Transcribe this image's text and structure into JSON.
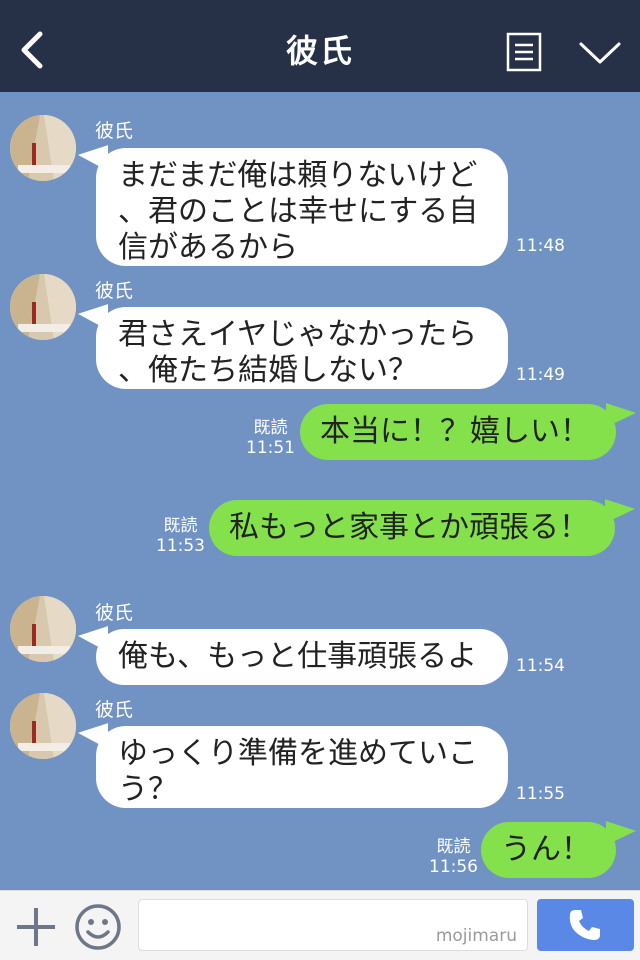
{
  "header": {
    "title": "彼氏"
  },
  "messages": [
    {
      "sender": "彼氏",
      "lines": [
        "まだまだ俺は頼りないけど",
        "、君のことは幸せにする自",
        "信があるから"
      ],
      "time": "11:48"
    },
    {
      "sender": "彼氏",
      "lines": [
        "君さえイヤじゃなかったら",
        "、俺たち結婚しない？"
      ],
      "time": "11:49"
    },
    {
      "text": "本当に！？嬉しい！",
      "read": "既読",
      "time": "11:51"
    },
    {
      "text": "私もっと家事とか頑張る！",
      "read": "既読",
      "time": "11:53"
    },
    {
      "sender": "彼氏",
      "lines": [
        "俺も、もっと仕事頑張るよ"
      ],
      "time": "11:54"
    },
    {
      "sender": "彼氏",
      "lines": [
        "ゆっくり準備を進めていこ",
        "う？"
      ],
      "time": "11:55"
    },
    {
      "text": "うん！",
      "read": "既読",
      "time": "11:56"
    }
  ],
  "footer": {
    "input_value": "",
    "watermark": "mojimaru"
  },
  "colors": {
    "header_bg": "#263047",
    "chat_bg": "#7193c4",
    "my_bubble": "#84e04b",
    "their_bubble": "#ffffff",
    "call_button": "#5a88e6"
  },
  "icons": [
    "back-arrow-icon",
    "menu-list-icon",
    "chevron-down-icon",
    "plus-icon",
    "smiley-icon",
    "phone-icon"
  ]
}
